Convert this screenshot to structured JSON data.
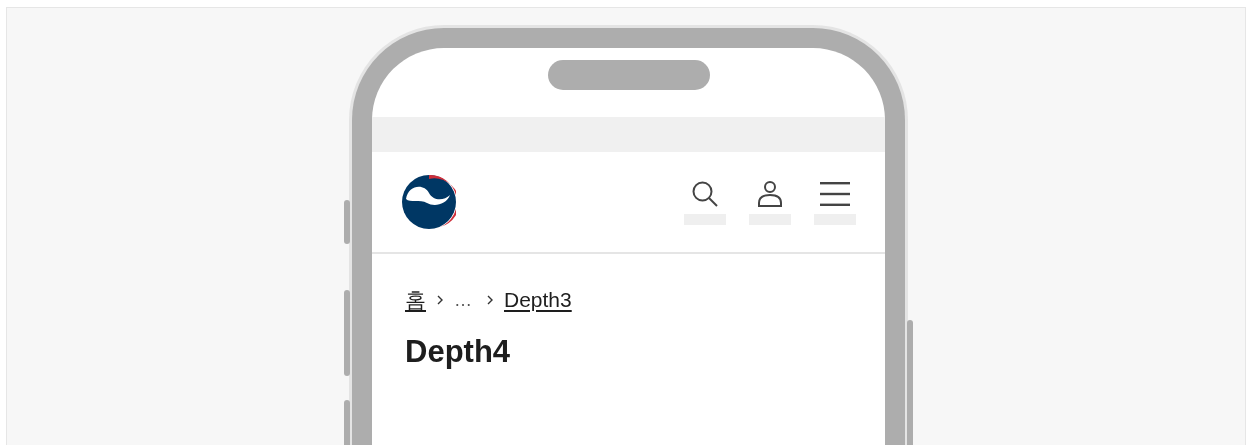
{
  "header": {
    "buttons": [
      {
        "kind": "search"
      },
      {
        "kind": "user"
      },
      {
        "kind": "menu"
      }
    ]
  },
  "breadcrumb": [
    {
      "text": "홈",
      "kind": "link"
    },
    {
      "text": "…",
      "kind": "ellipsis"
    },
    {
      "text": "Depth3",
      "kind": "link"
    }
  ],
  "title": "Depth4"
}
